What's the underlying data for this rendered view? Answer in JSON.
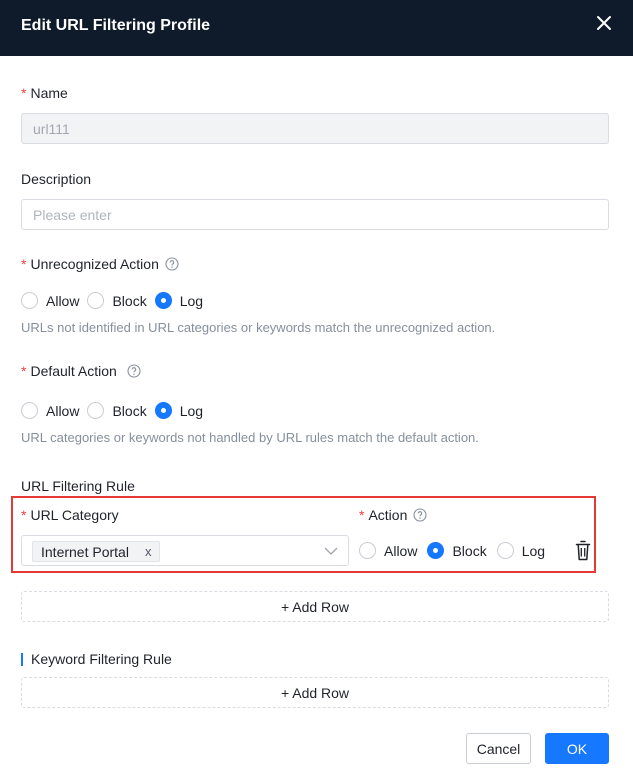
{
  "dialog": {
    "title": "Edit URL Filtering Profile"
  },
  "name": {
    "label": "Name",
    "value": "url111"
  },
  "description": {
    "label": "Description",
    "placeholder": "Please enter"
  },
  "unrecognized_action": {
    "label": "Unrecognized Action",
    "options": [
      "Allow",
      "Block",
      "Log"
    ],
    "selected": "Log",
    "hint": "URLs not identified in URL categories or keywords match the unrecognized action."
  },
  "default_action": {
    "label": "Default Action",
    "options": [
      "Allow",
      "Block",
      "Log"
    ],
    "selected": "Log",
    "hint": "URL categories or keywords not handled by URL rules match the default action."
  },
  "url_rule": {
    "section_label": "URL Filtering Rule",
    "category_label": "URL Category",
    "action_label": "Action",
    "category_tag": "Internet Portal",
    "tag_remove": "x",
    "action_options": [
      "Allow",
      "Block",
      "Log"
    ],
    "action_selected": "Block",
    "add_row": "+ Add Row"
  },
  "keyword_rule": {
    "section_label": "Keyword Filtering Rule",
    "add_row": "+ Add Row"
  },
  "footer": {
    "cancel": "Cancel",
    "ok": "OK"
  },
  "colors": {
    "header_bg": "#0f1b2a",
    "accent": "#1677ff",
    "required": "#f53f3f",
    "highlight_box": "#e53935"
  },
  "icons": {
    "close": "close-icon",
    "help": "question-circle-icon",
    "dropdown": "chevron-down-icon",
    "delete": "trash-icon"
  }
}
